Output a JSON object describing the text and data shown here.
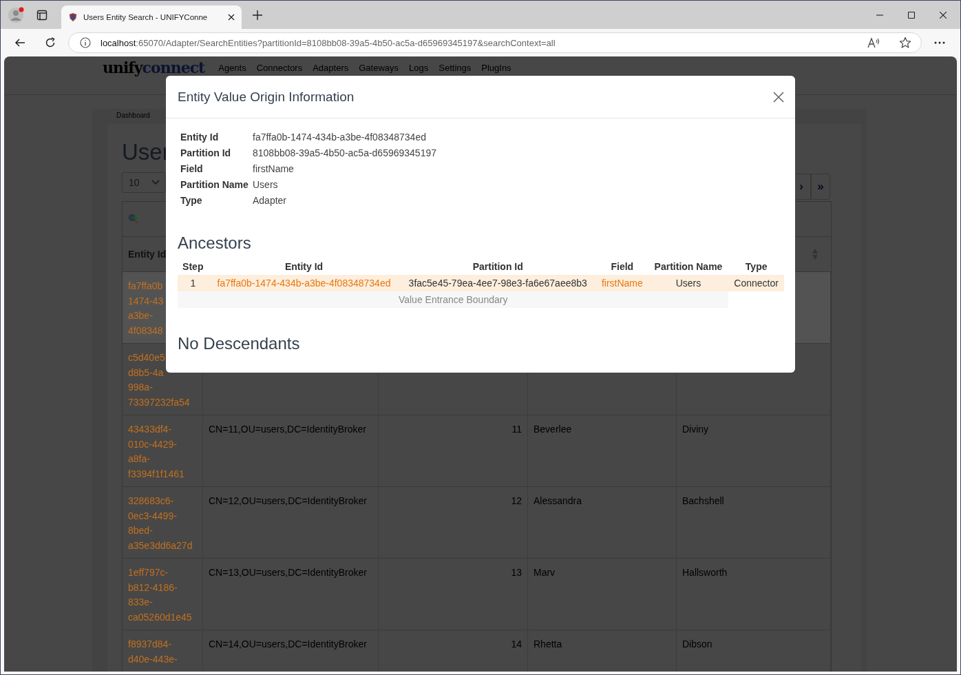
{
  "browser": {
    "tab_title": "Users Entity Search - UNIFYConne",
    "url_host": "localhost",
    "url_path": ":65070/Adapter/SearchEntities?partitionId=8108bb08-39a5-4b50-ac5a-d65969345197&searchContext=all"
  },
  "header": {
    "logo_first": "unify",
    "logo_second": "connect",
    "nav": [
      "Agents",
      "Connectors",
      "Adapters",
      "Gateways",
      "Logs",
      "Settings",
      "PlugIns"
    ]
  },
  "breadcrumb": "Dashboard",
  "page_title": "User",
  "page_size": "10",
  "pagination": [
    "›",
    "»"
  ],
  "table": {
    "columns": [
      "Entity Id"
    ],
    "rows": [
      {
        "selected": true,
        "id_lines": [
          "fa7ffa0b",
          "1474-43",
          "a3be-",
          "4f08348"
        ]
      },
      {
        "selected": false,
        "id_lines": [
          "c5d40e5",
          "d8b5-4a",
          "998a-",
          "73397232fa54"
        ]
      },
      {
        "selected": false,
        "id_lines": [
          "43433df4-",
          "010c-4429-",
          "a8fa-",
          "f3394f1f1461"
        ],
        "dn": "CN=11,OU=users,DC=IdentityBroker",
        "number": "11",
        "first": "Beverlee",
        "last": "Diviny"
      },
      {
        "selected": false,
        "id_lines": [
          "328683c6-",
          "0ec3-4499-",
          "8bed-",
          "a35e3dd6a27d"
        ],
        "dn": "CN=12,OU=users,DC=IdentityBroker",
        "number": "12",
        "first": "Alessandra",
        "last": "Bachshell"
      },
      {
        "selected": false,
        "id_lines": [
          "1eff797c-",
          "b812-4186-",
          "833e-",
          "ca05260d1e45"
        ],
        "dn": "CN=13,OU=users,DC=IdentityBroker",
        "number": "13",
        "first": "Marv",
        "last": "Hallsworth"
      },
      {
        "selected": false,
        "id_lines": [
          "f8937d84-",
          "d40e-443e-"
        ],
        "dn": "CN=14,OU=users,DC=IdentityBroker",
        "number": "14",
        "first": "Rhetta",
        "last": "Dibson"
      }
    ]
  },
  "modal": {
    "title": "Entity Value Origin Information",
    "details": [
      {
        "label": "Entity Id",
        "value": "fa7ffa0b-1474-434b-a3be-4f08348734ed"
      },
      {
        "label": "Partition Id",
        "value": "8108bb08-39a5-4b50-ac5a-d65969345197"
      },
      {
        "label": "Field",
        "value": "firstName"
      },
      {
        "label": "Partition Name",
        "value": "Users"
      },
      {
        "label": "Type",
        "value": "Adapter"
      }
    ],
    "ancestors_heading": "Ancestors",
    "ancestors": {
      "columns": [
        "Step",
        "Entity Id",
        "Partition Id",
        "Field",
        "Partition Name",
        "Type"
      ],
      "rows": [
        {
          "step": "1",
          "entity_id": "fa7ffa0b-1474-434b-a3be-4f08348734ed",
          "partition_id": "3fac5e45-79ea-4ee7-98e3-fa6e67aee8b3",
          "field": "firstName",
          "partition_name": "Users",
          "type": "Connector"
        }
      ],
      "boundary": "Value Entrance Boundary"
    },
    "descendants_heading": "No Descendants"
  }
}
